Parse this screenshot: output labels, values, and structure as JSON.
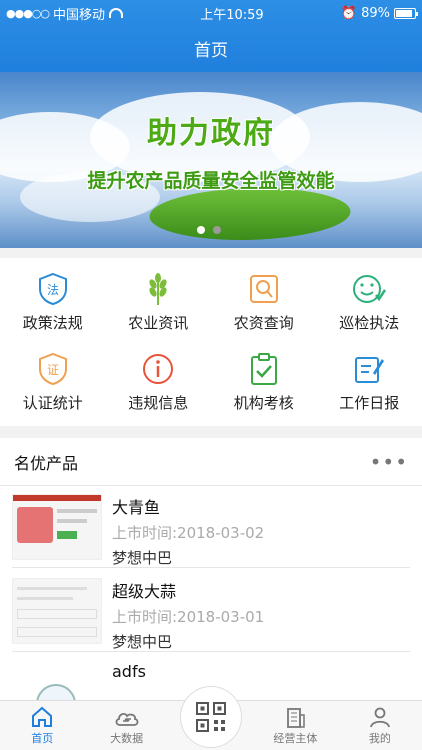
{
  "status": {
    "carrier": "中国移动",
    "time": "上午10:59",
    "battery": "89%",
    "battery_level": 0.89,
    "signal_dots": "●●●○○"
  },
  "nav": {
    "title": "首页"
  },
  "banner": {
    "title": "助力政府",
    "subtitle": "提升农产品质量安全监管效能",
    "page_count": 2,
    "active_page": 1
  },
  "quick_menu": [
    {
      "label": "政策法规",
      "icon": "law-shield-icon",
      "color": "#2a8bd6"
    },
    {
      "label": "农业资讯",
      "icon": "wheat-icon",
      "color": "#7cbd3b"
    },
    {
      "label": "农资查询",
      "icon": "search-doc-icon",
      "color": "#f0a050"
    },
    {
      "label": "巡检执法",
      "icon": "smile-check-icon",
      "color": "#2db07a"
    },
    {
      "label": "认证统计",
      "icon": "certificate-shield-icon",
      "color": "#f0a050"
    },
    {
      "label": "违规信息",
      "icon": "info-circle-icon",
      "color": "#e8543a"
    },
    {
      "label": "机构考核",
      "icon": "clipboard-check-icon",
      "color": "#3aa845"
    },
    {
      "label": "工作日报",
      "icon": "edit-report-icon",
      "color": "#2a8bd6"
    }
  ],
  "products": {
    "title": "名优产品",
    "more_icon": "more-dots-icon",
    "items": [
      {
        "name": "大青鱼",
        "date": "上市时间:2018-03-02",
        "org": "梦想中巴"
      },
      {
        "name": "超级大蒜",
        "date": "上市时间:2018-03-01",
        "org": "梦想中巴"
      },
      {
        "name": "adfs"
      }
    ]
  },
  "tabs": [
    {
      "label": "首页",
      "icon": "home-icon",
      "active": true
    },
    {
      "label": "大数据",
      "icon": "cloud-data-icon",
      "active": false
    },
    {
      "label": "",
      "icon": "qr-scan-icon",
      "active": false
    },
    {
      "label": "经营主体",
      "icon": "building-icon",
      "active": false
    },
    {
      "label": "我的",
      "icon": "user-icon",
      "active": false
    }
  ],
  "colors": {
    "primary": "#1f7fdc",
    "banner_text": "#4caa14"
  }
}
